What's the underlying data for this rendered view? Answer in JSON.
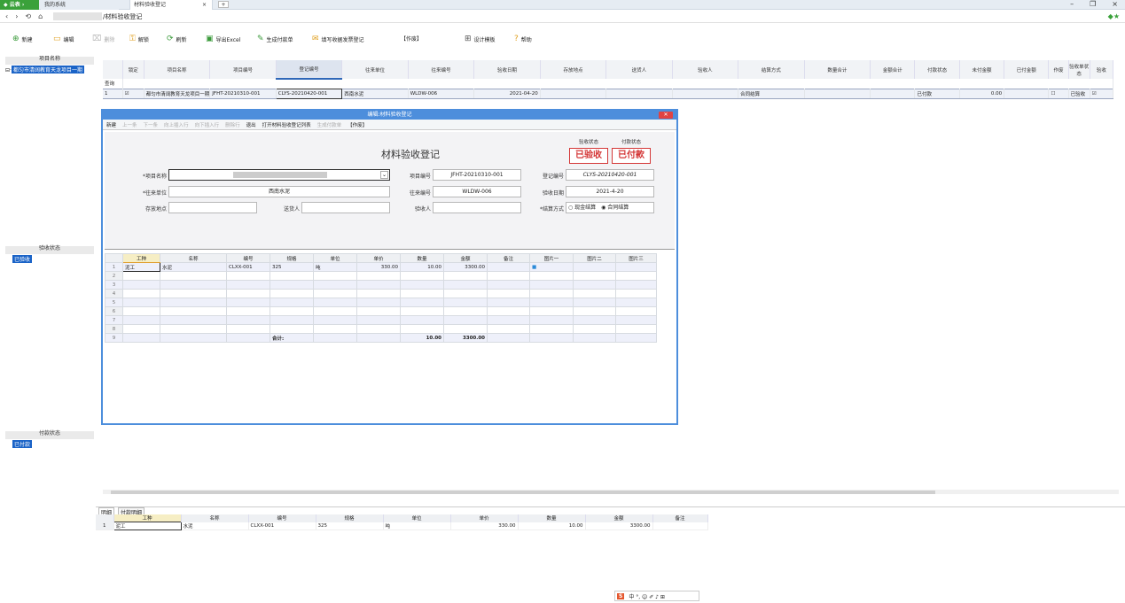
{
  "tabs": {
    "brand": "◆ 云表",
    "brand_arrow": "›",
    "system": "我的系统",
    "active": "材料验收登记",
    "close": "×",
    "add": "+"
  },
  "window": {
    "min": "–",
    "max": "❐",
    "close": "×"
  },
  "addr": {
    "back": "‹",
    "fwd": "›",
    "reload": "⟲",
    "home": "⌂",
    "path": "/材料验收登记",
    "right": "◆★"
  },
  "toolbar": [
    {
      "icon": "⊕",
      "label": "新建"
    },
    {
      "icon": "▭",
      "label": "编辑"
    },
    {
      "icon": "⌧",
      "label": "删除",
      "disabled": true
    },
    {
      "icon": "⚿",
      "label": "解锁"
    },
    {
      "icon": "⟳",
      "label": "刷新"
    },
    {
      "icon": "▣",
      "label": "导出Excel"
    },
    {
      "icon": "✎",
      "label": "生成付款单"
    },
    {
      "icon": "✉",
      "label": "填写收据发票登记"
    },
    {
      "icon": "",
      "label": "【作废】"
    },
    {
      "icon": "⊞",
      "label": "设计模板"
    },
    {
      "icon": "?",
      "label": "帮助"
    }
  ],
  "left": {
    "project_header": "项目名称",
    "project_item": "都匀市清阔教育天龙项目一期",
    "check_header": "验收状态",
    "check_item": "已验收",
    "pay_header": "付款状态",
    "pay_item": "已付款"
  },
  "grid": {
    "headers": [
      "",
      "锁定",
      "项目名称",
      "项目编号",
      "登记编号",
      "往来单位",
      "往来编号",
      "验收日期",
      "存放地点",
      "送货人",
      "验收人",
      "结算方式",
      "数量合计",
      "金额合计",
      "付款状态",
      "未付金额",
      "已付金额",
      "作废",
      "验收单状态",
      "验收"
    ],
    "query_label": "查询",
    "row": {
      "no": "1",
      "lock": "☑",
      "project": "都匀市清阔教育天龙项目一期",
      "project_no": "JFHT-20210310-001",
      "reg_no": "CLYS-20210420-001",
      "unit": "西南水泥",
      "unit_no": "WLDW-006",
      "date": "2021-04-20",
      "place": "",
      "deliver": "",
      "checker": "",
      "settle": "合同结算",
      "qty": "",
      "amount": "",
      "pay_status": "已付款",
      "unpaid": "0.00",
      "paid": "",
      "void": "☐",
      "check_status": "已验收",
      "checked": "☑"
    }
  },
  "dialog": {
    "title": "编辑:材料验收登记",
    "close": "✕",
    "toolbar": [
      "新建",
      "上一条",
      "下一条",
      "向上插入行",
      "向下插入行",
      "删除行",
      "退出",
      "打开材料验收登记列表",
      "生成付款单",
      "【作废】"
    ],
    "form_title": "材料验收登记",
    "check_state_label": "验收状态",
    "check_state": "已验收",
    "pay_state_label": "付款状态",
    "pay_state": "已付款",
    "fields": {
      "project_label": "*项目名称",
      "project_value": "",
      "project_no_label": "项目编号",
      "project_no": "JFHT-20210310-001",
      "reg_no_label": "登记编号",
      "reg_no": "CLYS-20210420-001",
      "unit_label": "*往来单位",
      "unit": "西南水泥",
      "unit_no_label": "往来编号",
      "unit_no": "WLDW-006",
      "date_label": "验收日期",
      "date": "2021-4-20",
      "place_label": "存放地点",
      "place": "",
      "deliver_label": "送货人",
      "deliver": "",
      "checker_label": "验收人",
      "checker": "",
      "settle_label": "*结算方式",
      "settle_opt1": "现金结算",
      "settle_opt2": "合同结算"
    },
    "detail_headers": [
      "",
      "工种",
      "名称",
      "编号",
      "规格",
      "单位",
      "单价",
      "数量",
      "金额",
      "备注",
      "图片一",
      "图片二",
      "图片三"
    ],
    "rows": [
      [
        "1",
        "泥工",
        "水泥",
        "CLXX-001",
        "325",
        "吨",
        "330.00",
        "10.00",
        "3300.00",
        "",
        "■",
        "",
        ""
      ],
      [
        "2",
        "",
        "",
        "",
        "",
        "",
        "",
        "",
        "",
        "",
        "",
        "",
        ""
      ],
      [
        "3",
        "",
        "",
        "",
        "",
        "",
        "",
        "",
        "",
        "",
        "",
        "",
        ""
      ],
      [
        "4",
        "",
        "",
        "",
        "",
        "",
        "",
        "",
        "",
        "",
        "",
        "",
        ""
      ],
      [
        "5",
        "",
        "",
        "",
        "",
        "",
        "",
        "",
        "",
        "",
        "",
        "",
        ""
      ],
      [
        "6",
        "",
        "",
        "",
        "",
        "",
        "",
        "",
        "",
        "",
        "",
        "",
        ""
      ],
      [
        "7",
        "",
        "",
        "",
        "",
        "",
        "",
        "",
        "",
        "",
        "",
        "",
        ""
      ],
      [
        "8",
        "",
        "",
        "",
        "",
        "",
        "",
        "",
        "",
        "",
        "",
        "",
        ""
      ],
      [
        "9",
        "",
        "",
        "",
        "合计:",
        "",
        "",
        "10.00",
        "3300.00",
        "",
        "",
        "",
        ""
      ]
    ]
  },
  "bottom": {
    "tabs": [
      "明细",
      "付款明细"
    ],
    "headers": [
      "",
      "工种",
      "名称",
      "编号",
      "规格",
      "单位",
      "单价",
      "数量",
      "金额",
      "备注"
    ],
    "row": [
      "1",
      "泥工",
      "水泥",
      "CLXX-001",
      "325",
      "吨",
      "330.00",
      "10.00",
      "3300.00",
      ""
    ]
  },
  "ime": {
    "logo": "S",
    "items": "中 °, ☺ ✐ ♪ ⊞"
  }
}
